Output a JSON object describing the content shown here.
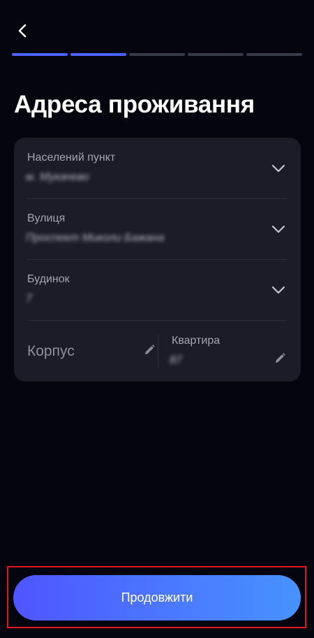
{
  "header": {
    "back_icon": "chevron-left-icon",
    "progress": {
      "total_steps": 5,
      "completed_steps": 2
    }
  },
  "page": {
    "title": "Адреса проживання"
  },
  "form": {
    "settlement": {
      "label": "Населений пункт",
      "value": "м. Мукачево"
    },
    "street": {
      "label": "Вулиця",
      "value": "Проспект Миколи Бажана"
    },
    "building": {
      "label": "Будинок",
      "value": "7"
    },
    "korpus": {
      "placeholder": "Корпус"
    },
    "apartment": {
      "label": "Квартира",
      "value": "87"
    }
  },
  "footer": {
    "continue_label": "Продовжити"
  },
  "colors": {
    "background": "#05050f",
    "card": "#1c1c28",
    "progress_active": "#4b63ff",
    "progress_inactive": "#3a3b49",
    "button_gradient_start": "#4f55ff",
    "button_gradient_end": "#4792ff",
    "highlight": "#e0141e"
  }
}
